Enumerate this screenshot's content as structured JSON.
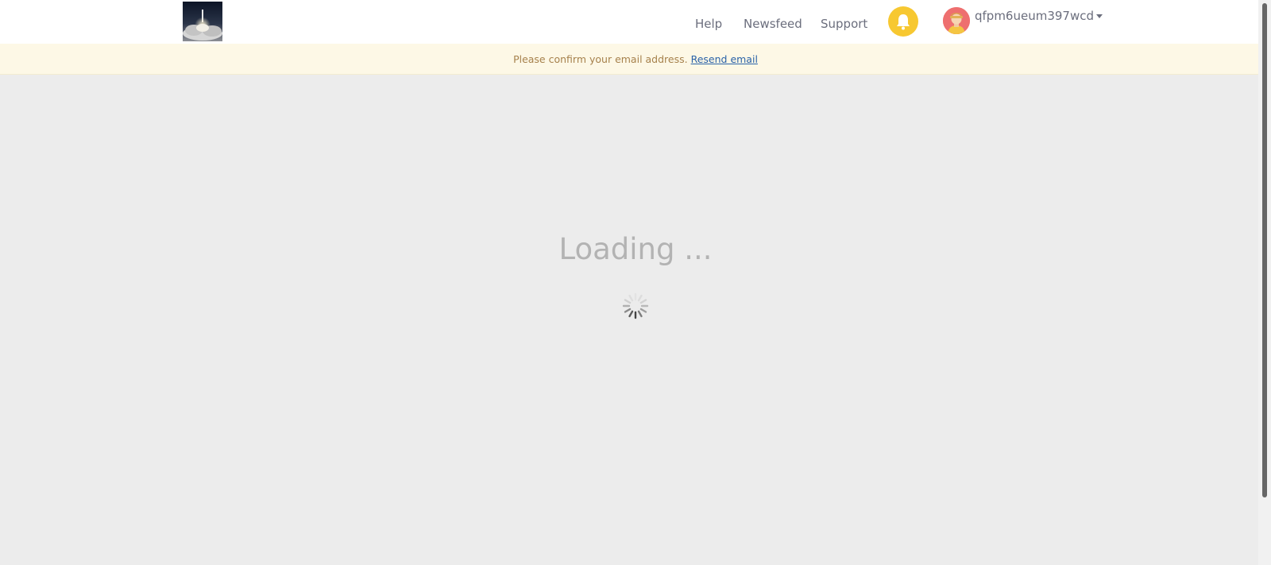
{
  "nav": {
    "help": "Help",
    "newsfeed": "Newsfeed",
    "support": "Support"
  },
  "user": {
    "username": "qfpm6ueum397wcd"
  },
  "banner": {
    "message": "Please confirm your email address.",
    "link": "Resend email"
  },
  "loading": {
    "text": "Loading ..."
  },
  "icons": {
    "logo": "rocket-launch-logo",
    "notifications": "bell-icon",
    "avatar": "user-avatar",
    "menu": "caret-down-icon",
    "spinner": "loading-spinner"
  },
  "colors": {
    "bell_bg": "#f7c831",
    "avatar_bg": "#ee6f6f",
    "banner_bg": "#fdf8e6",
    "banner_text": "#a6814c",
    "link": "#2a62a8",
    "page_bg": "#ececec"
  }
}
